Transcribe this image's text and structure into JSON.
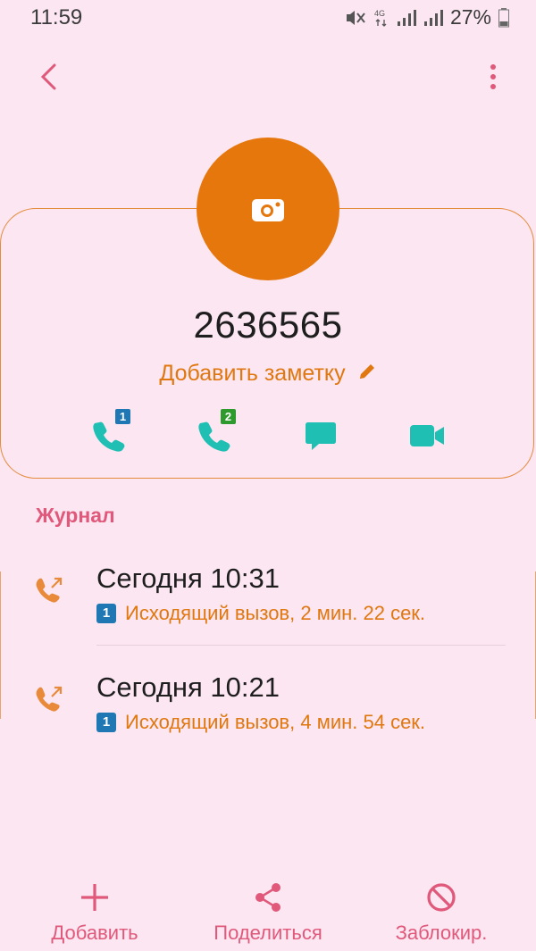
{
  "status_bar": {
    "time": "11:59",
    "network": "4G",
    "battery": "27%",
    "icons": [
      "mute-icon",
      "network-4g-icon",
      "signal-icon",
      "signal-icon",
      "battery-icon"
    ]
  },
  "header": {
    "back_icon": "chevron-left-icon",
    "more_icon": "more-vertical-icon"
  },
  "contact": {
    "phone_number": "2636565",
    "add_note_label": "Добавить заметку",
    "avatar_icon": "camera-icon",
    "actions": [
      {
        "name": "call-sim1-button",
        "icon": "phone-icon",
        "badge": "1",
        "badge_color": "#1f78b4"
      },
      {
        "name": "call-sim2-button",
        "icon": "phone-icon",
        "badge": "2",
        "badge_color": "#2e9a2e"
      },
      {
        "name": "message-button",
        "icon": "message-icon"
      },
      {
        "name": "video-call-button",
        "icon": "video-icon"
      }
    ]
  },
  "journal": {
    "title": "Журнал",
    "items": [
      {
        "time": "Сегодня 10:31",
        "sim": "1",
        "detail": "Исходящий вызов, 2 мин. 22 сек."
      },
      {
        "time": "Сегодня 10:21",
        "sim": "1",
        "detail": "Исходящий вызов, 4 мин. 54 сек."
      }
    ]
  },
  "bottom_bar": {
    "add_label": "Добавить",
    "share_label": "Поделиться",
    "block_label": "Заблокир."
  },
  "colors": {
    "background": "#fbe6f2",
    "accent_orange": "#e6770c",
    "accent_pink": "#e0587a",
    "teal": "#1fc0b3"
  }
}
